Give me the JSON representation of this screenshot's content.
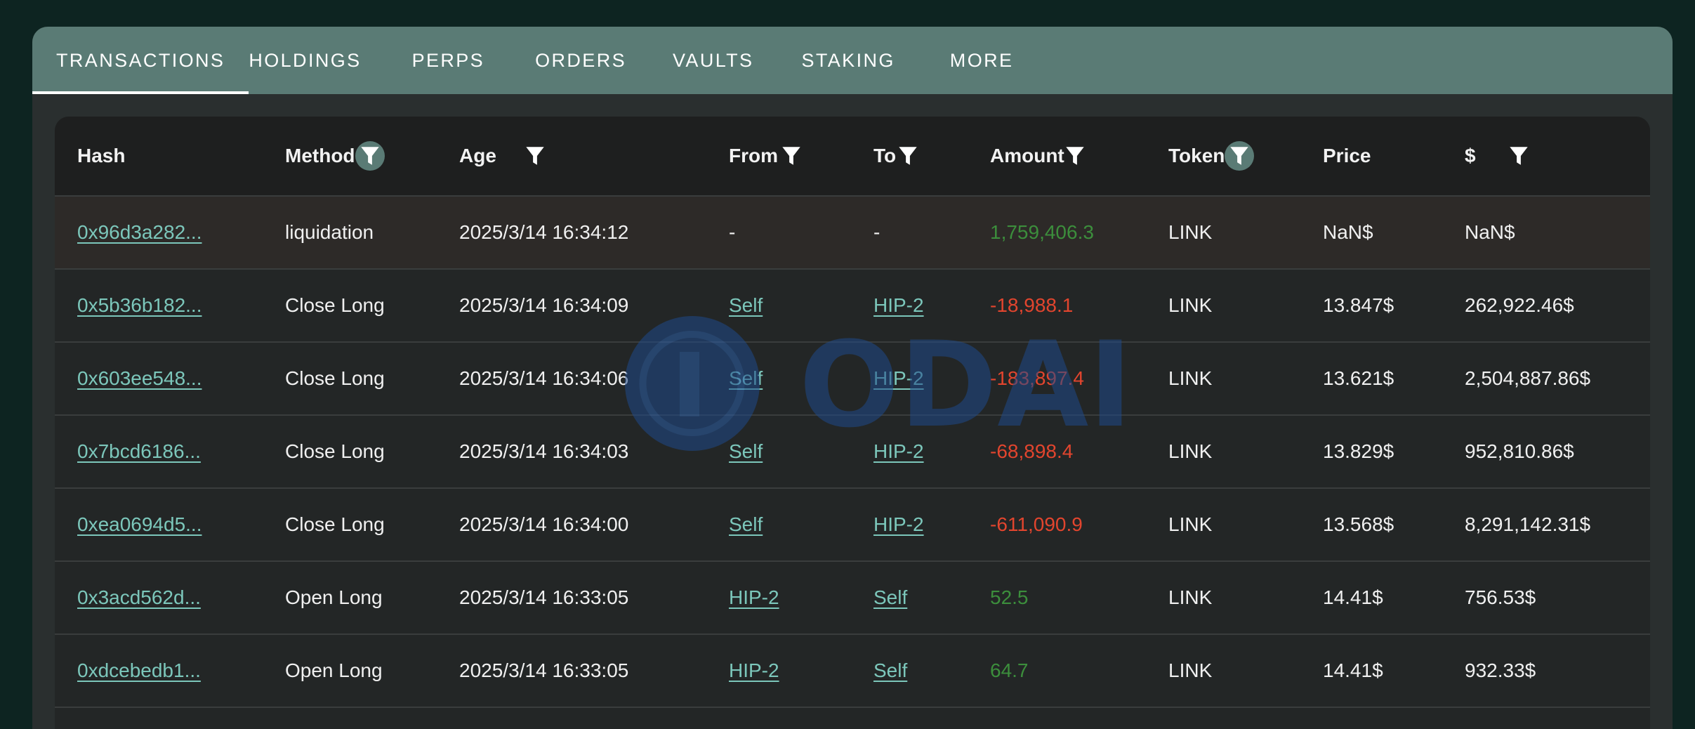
{
  "tabs": [
    {
      "label": "TRANSACTIONS",
      "active": true
    },
    {
      "label": "HOLDINGS",
      "active": false
    },
    {
      "label": "PERPS",
      "active": false
    },
    {
      "label": "ORDERS",
      "active": false
    },
    {
      "label": "VAULTS",
      "active": false
    },
    {
      "label": "STAKING",
      "active": false
    },
    {
      "label": "MORE",
      "active": false
    }
  ],
  "columns": {
    "hash": "Hash",
    "method": "Method",
    "age": "Age",
    "from": "From",
    "to": "To",
    "amount": "Amount",
    "token": "Token",
    "price": "Price",
    "usd": "$"
  },
  "colors": {
    "positive": "#3c8e3c",
    "negative": "#e2452e",
    "link": "#7cc7bb",
    "accent": "#5a7b75"
  },
  "rows": [
    {
      "hash": "0x96d3a282...",
      "method": "liquidation",
      "age": "2025/3/14 16:34:12",
      "from": "-",
      "to": "-",
      "amount": "1,759,406.3",
      "sign": "pos",
      "token": "LINK",
      "price": "NaN$",
      "usd": "NaN$"
    },
    {
      "hash": "0x5b36b182...",
      "method": "Close Long",
      "age": "2025/3/14 16:34:09",
      "from": "Self",
      "to": "HIP-2",
      "amount": "-18,988.1",
      "sign": "neg",
      "token": "LINK",
      "price": "13.847$",
      "usd": "262,922.46$"
    },
    {
      "hash": "0x603ee548...",
      "method": "Close Long",
      "age": "2025/3/14 16:34:06",
      "from": "Self",
      "to": "HIP-2",
      "amount": "-183,897.4",
      "sign": "neg",
      "token": "LINK",
      "price": "13.621$",
      "usd": "2,504,887.86$"
    },
    {
      "hash": "0x7bcd6186...",
      "method": "Close Long",
      "age": "2025/3/14 16:34:03",
      "from": "Self",
      "to": "HIP-2",
      "amount": "-68,898.4",
      "sign": "neg",
      "token": "LINK",
      "price": "13.829$",
      "usd": "952,810.86$"
    },
    {
      "hash": "0xea0694d5...",
      "method": "Close Long",
      "age": "2025/3/14 16:34:00",
      "from": "Self",
      "to": "HIP-2",
      "amount": "-611,090.9",
      "sign": "neg",
      "token": "LINK",
      "price": "13.568$",
      "usd": "8,291,142.31$"
    },
    {
      "hash": "0x3acd562d...",
      "method": "Open Long",
      "age": "2025/3/14 16:33:05",
      "from": "HIP-2",
      "to": "Self",
      "amount": "52.5",
      "sign": "pos",
      "token": "LINK",
      "price": "14.41$",
      "usd": "756.53$"
    },
    {
      "hash": "0xdcebedb1...",
      "method": "Open Long",
      "age": "2025/3/14 16:33:05",
      "from": "HIP-2",
      "to": "Self",
      "amount": "64.7",
      "sign": "pos",
      "token": "LINK",
      "price": "14.41$",
      "usd": "932.33$"
    }
  ],
  "watermark": {
    "text": "ODAILY"
  }
}
